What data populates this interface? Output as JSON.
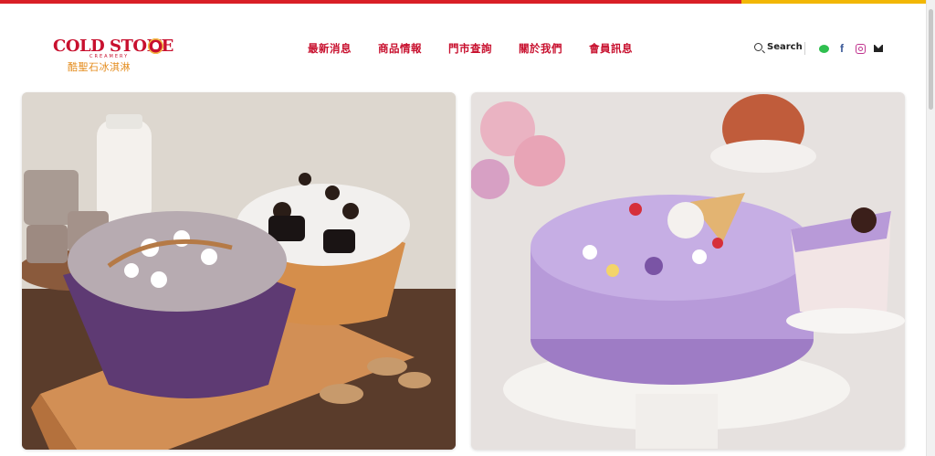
{
  "brand": {
    "name": "COLD STONE",
    "sub": "CREAMERY",
    "chinese": "酷聖石冰淇淋"
  },
  "nav": {
    "items": [
      "最新消息",
      "商品情報",
      "門市查詢",
      "關於我們",
      "會員訊息"
    ]
  },
  "search": {
    "label": "Search"
  },
  "social": [
    "line-icon",
    "facebook-icon",
    "instagram-icon",
    "mail-icon"
  ],
  "colors": {
    "primary": "#c8102e",
    "accent": "#f2b705"
  }
}
